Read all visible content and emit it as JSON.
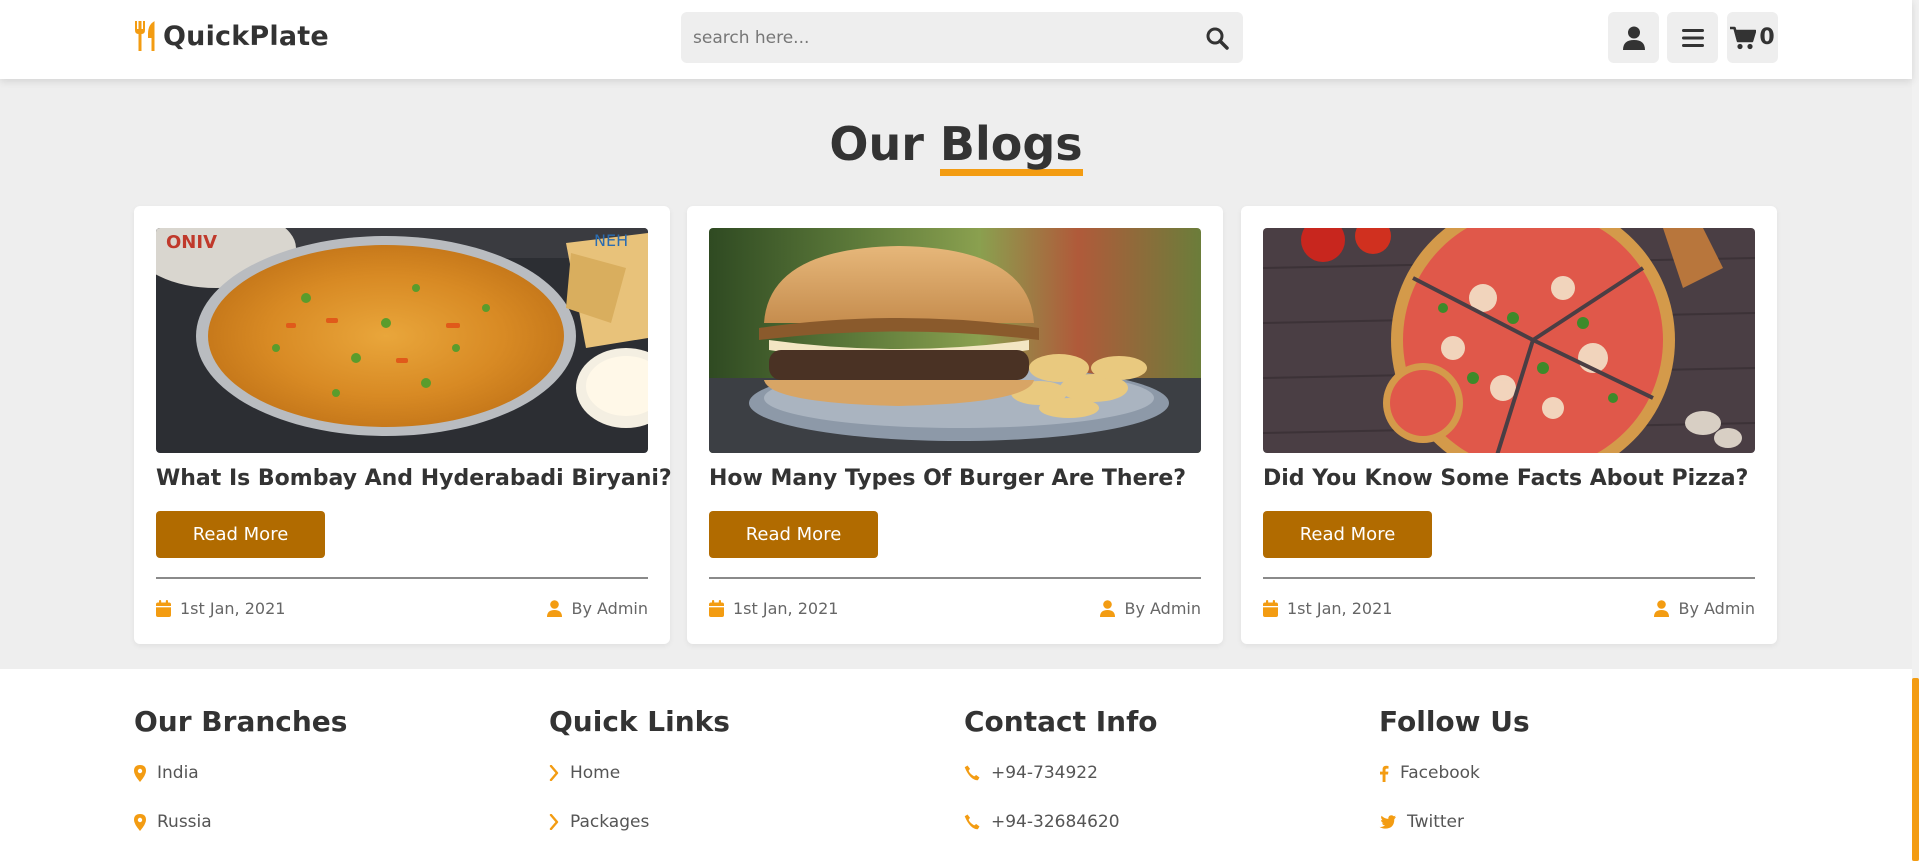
{
  "colors": {
    "accent": "#f39c12",
    "button": "#b16b00",
    "text": "#333333",
    "background": "#eeeeee"
  },
  "header": {
    "logo_text": "QuickPlate",
    "logo_icon": "utensils-icon",
    "search": {
      "placeholder": "search here...",
      "icon": "search-icon"
    },
    "buttons": [
      {
        "icon": "user-icon"
      },
      {
        "icon": "menu-icon"
      },
      {
        "icon": "cart-icon",
        "count": "0"
      }
    ]
  },
  "blogs": {
    "title_prefix": "Our",
    "title_accent": "Blogs",
    "cards": [
      {
        "title": "What Is Bombay And Hyderabadi Biryani?",
        "button_label": "Read More",
        "date": "1st Jan, 2021",
        "author": "By Admin",
        "image": "biryani-image"
      },
      {
        "title": "How Many Types Of Burger Are There?",
        "button_label": "Read More",
        "date": "1st Jan, 2021",
        "author": "By Admin",
        "image": "burger-image"
      },
      {
        "title": "Did You Know Some Facts About Pizza?",
        "button_label": "Read More",
        "date": "1st Jan, 2021",
        "author": "By Admin",
        "image": "pizza-image"
      }
    ]
  },
  "footer": {
    "branches": {
      "heading": "Our Branches",
      "items": [
        "India",
        "Russia"
      ]
    },
    "quick_links": {
      "heading": "Quick Links",
      "items": [
        "Home",
        "Packages"
      ]
    },
    "contact": {
      "heading": "Contact Info",
      "items": [
        "+94-734922",
        "+94-32684620"
      ]
    },
    "follow": {
      "heading": "Follow Us",
      "items": [
        "Facebook",
        "Twitter"
      ]
    }
  }
}
